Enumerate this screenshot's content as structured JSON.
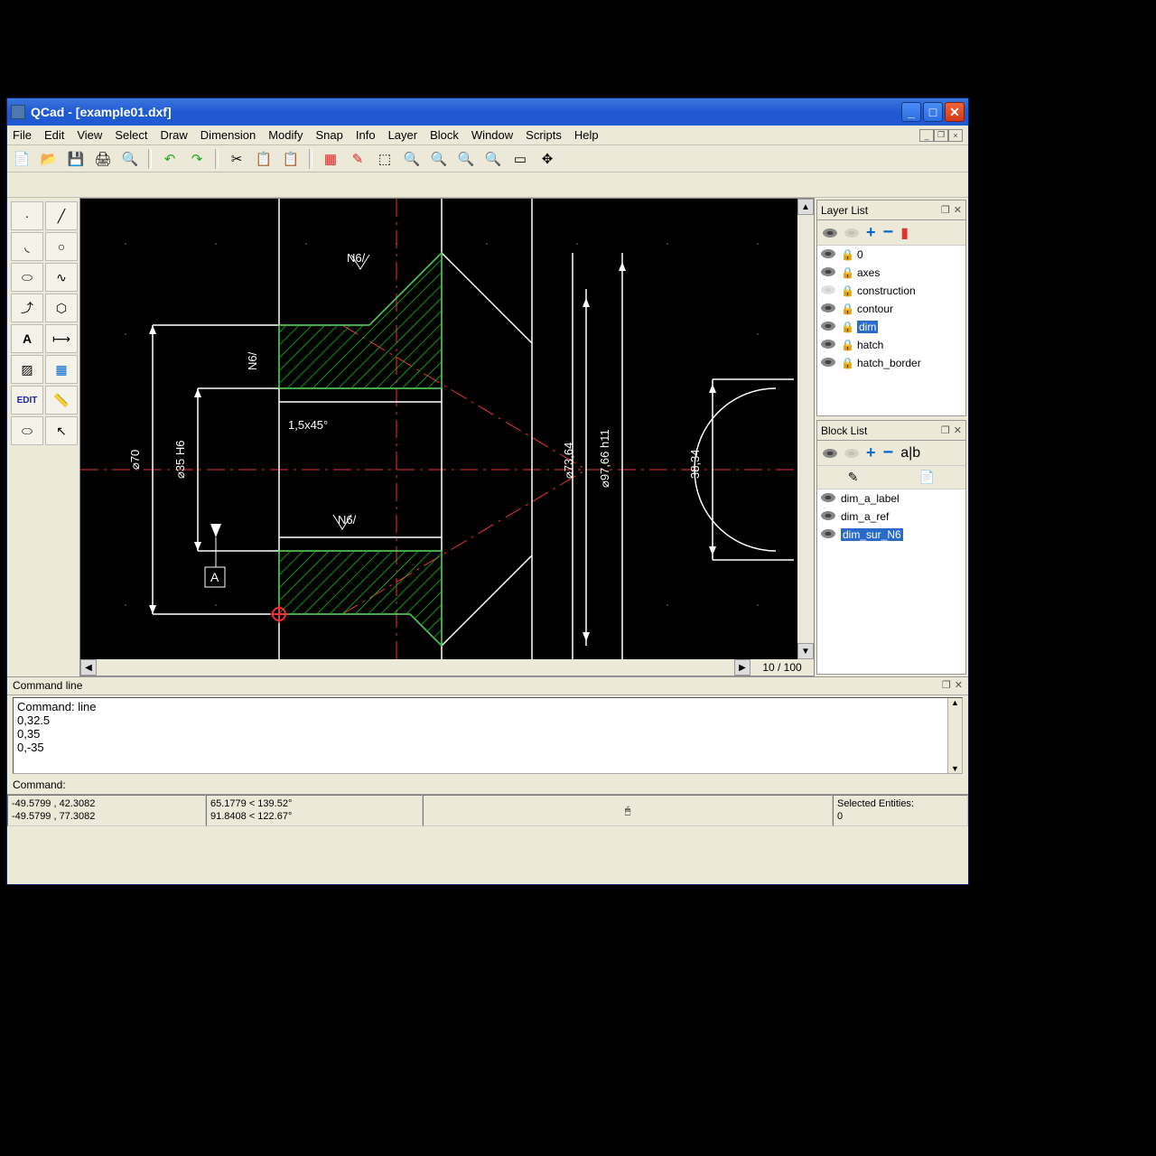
{
  "window": {
    "title": "QCad - [example01.dxf]"
  },
  "menu": [
    "File",
    "Edit",
    "View",
    "Select",
    "Draw",
    "Dimension",
    "Modify",
    "Snap",
    "Info",
    "Layer",
    "Block",
    "Window",
    "Scripts",
    "Help"
  ],
  "toolbar_icons": [
    "new",
    "open",
    "save",
    "print",
    "print-preview",
    "|",
    "undo",
    "redo",
    "|",
    "cut",
    "copy",
    "paste",
    "|",
    "grid",
    "ortho",
    "select-window",
    "zoom-in",
    "zoom-out",
    "zoom-extents",
    "zoom-window",
    "pan",
    "move"
  ],
  "tool_palette": [
    [
      "point",
      "line"
    ],
    [
      "arc",
      "circle"
    ],
    [
      "ellipse",
      "spline"
    ],
    [
      "polyline",
      "lwpoly"
    ],
    [
      "text",
      "dimension"
    ],
    [
      "hatch",
      "grid-snap"
    ],
    [
      "edit",
      "measure"
    ],
    [
      "trim",
      "info"
    ]
  ],
  "layer_panel": {
    "title": "Layer List",
    "items": [
      {
        "name": "0",
        "visible": true
      },
      {
        "name": "axes",
        "visible": true
      },
      {
        "name": "construction",
        "visible": false
      },
      {
        "name": "contour",
        "visible": true
      },
      {
        "name": "dim",
        "visible": true,
        "selected": true
      },
      {
        "name": "hatch",
        "visible": true
      },
      {
        "name": "hatch_border",
        "visible": true
      }
    ]
  },
  "block_panel": {
    "title": "Block List",
    "items": [
      {
        "name": "dim_a_label",
        "visible": true
      },
      {
        "name": "dim_a_ref",
        "visible": true
      },
      {
        "name": "dim_sur_N6",
        "visible": true,
        "selected": true
      }
    ]
  },
  "scroll_ratio": "10 / 100",
  "command_panel": {
    "title": "Command line",
    "history": [
      "Command: line",
      "0,32.5",
      "0,35",
      "0,-35"
    ],
    "prompt": "Command:"
  },
  "status": {
    "abs_coord": "-49.5799 , 42.3082",
    "rel_coord": "-49.5799 , 77.3082",
    "polar1": "65.1779 < 139.52°",
    "polar2": "91.8408 < 122.67°",
    "selected_label": "Selected Entities:",
    "selected_count": "0"
  },
  "drawing_labels": {
    "dim70": "⌀70",
    "dim35": "⌀35 H6",
    "dim7364": "⌀73,64",
    "dim9766": "⌀97,66 h11",
    "dim3834": "38,34",
    "chamfer": "1,5x45°",
    "surf_n6": "N6/",
    "datum_a": "A"
  }
}
